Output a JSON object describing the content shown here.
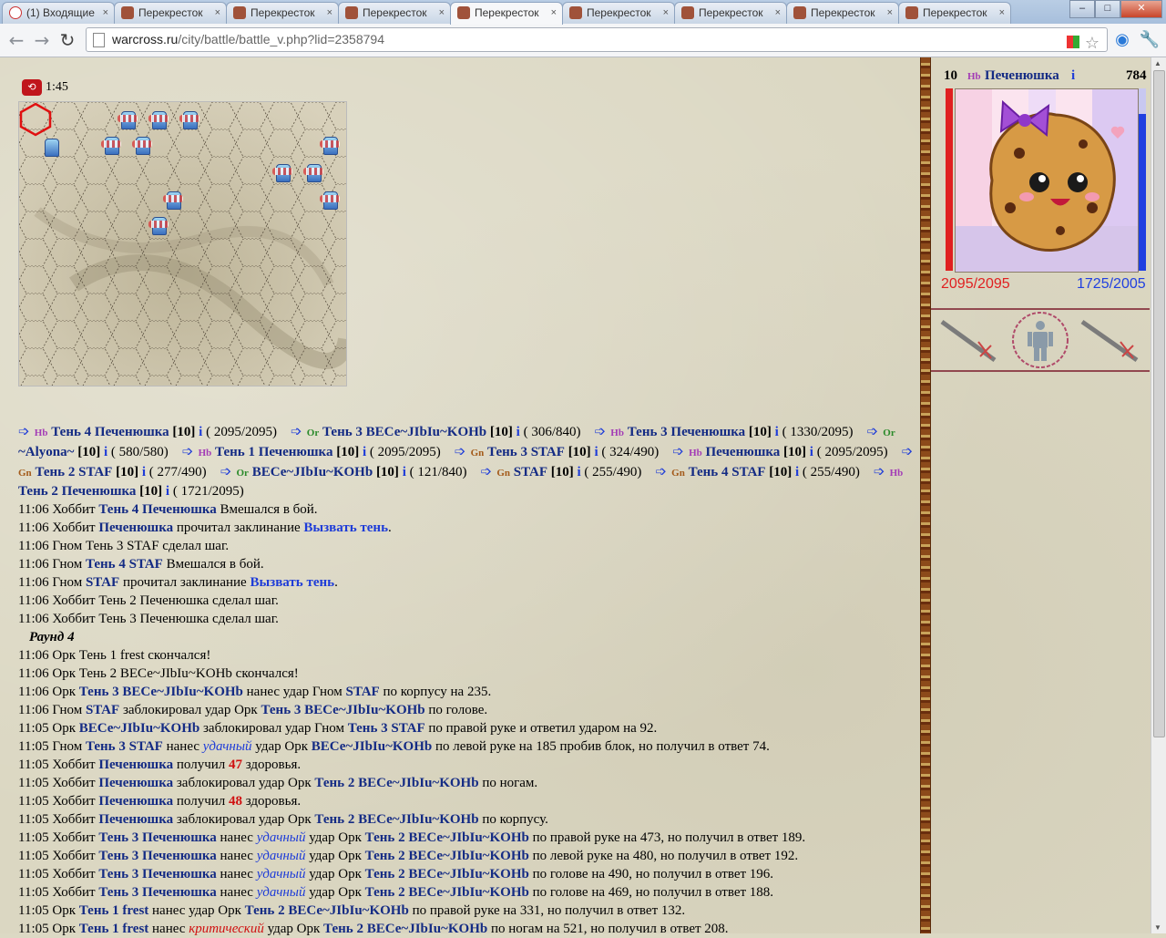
{
  "browser": {
    "tabs": [
      {
        "title": "(1) Входящие",
        "icon": "gmail-icon"
      },
      {
        "title": "Перекресток",
        "icon": "warcross-icon"
      },
      {
        "title": "Перекресток",
        "icon": "warcross-icon"
      },
      {
        "title": "Перекресток",
        "icon": "warcross-icon"
      },
      {
        "title": "Перекресток",
        "icon": "warcross-icon",
        "active": true
      },
      {
        "title": "Перекресток",
        "icon": "warcross-icon"
      },
      {
        "title": "Перекресток",
        "icon": "warcross-icon"
      },
      {
        "title": "Перекресток",
        "icon": "warcross-icon"
      },
      {
        "title": "Перекресток",
        "icon": "warcross-icon"
      }
    ],
    "url_host": "warcross.ru",
    "url_path": "/city/battle/battle_v.php?lid=2358794"
  },
  "battle": {
    "timer": "1:45"
  },
  "combatants": [
    {
      "race": "Hb",
      "name": "Тень 4 Печенюшка",
      "level": "[10]",
      "info": "i",
      "hp": "( 2095/2095)"
    },
    {
      "race": "Or",
      "name": "Тень 3 ВЕСе~JIbIu~KOHb",
      "level": "[10]",
      "info": "i",
      "hp": "( 306/840)"
    },
    {
      "race": "Hb",
      "name": "Тень 3 Печенюшка",
      "level": "[10]",
      "info": "i",
      "hp": "( 1330/2095)"
    },
    {
      "race": "Or",
      "name": "~Alyona~",
      "level": "[10]",
      "info": "i",
      "hp": "( 580/580)"
    },
    {
      "race": "Hb",
      "name": "Тень 1 Печенюшка",
      "level": "[10]",
      "info": "i",
      "hp": "( 2095/2095)"
    },
    {
      "race": "Gn",
      "name": "Тень 3 STAF",
      "level": "[10]",
      "info": "i",
      "hp": "( 324/490)"
    },
    {
      "race": "Hb",
      "name": "Печенюшка",
      "level": "[10]",
      "info": "i",
      "hp": "( 2095/2095)"
    },
    {
      "race": "Gn",
      "name": "Тень 2 STAF",
      "level": "[10]",
      "info": "i",
      "hp": "( 277/490)"
    },
    {
      "race": "Or",
      "name": "ВЕСе~JIbIu~KOHb",
      "level": "[10]",
      "info": "i",
      "hp": "( 121/840)"
    },
    {
      "race": "Gn",
      "name": "STAF",
      "level": "[10]",
      "info": "i",
      "hp": "( 255/490)"
    },
    {
      "race": "Gn",
      "name": "Тень 4 STAF",
      "level": "[10]",
      "info": "i",
      "hp": "( 255/490)"
    },
    {
      "race": "Hb",
      "name": "Тень 2 Печенюшка",
      "level": "[10]",
      "info": "i",
      "hp": "( 1721/2095)"
    }
  ],
  "log": [
    [
      {
        "t": "11:06 Хоббит "
      },
      {
        "a": "Тень 4 Печенюшка"
      },
      {
        "t": " Вмешался в бой."
      }
    ],
    [
      {
        "t": "11:06 Хоббит "
      },
      {
        "a": "Печенюшка"
      },
      {
        "t": " прочитал заклинание "
      },
      {
        "s": "Вызвать тень"
      },
      {
        "t": "."
      }
    ],
    [
      {
        "t": "11:06 Гном Тень 3 STAF сделал шаг."
      }
    ],
    [
      {
        "t": "11:06 Гном "
      },
      {
        "a": "Тень 4 STAF"
      },
      {
        "t": " Вмешался в бой."
      }
    ],
    [
      {
        "t": "11:06 Гном "
      },
      {
        "a": "STAF"
      },
      {
        "t": " прочитал заклинание "
      },
      {
        "s": "Вызвать тень"
      },
      {
        "t": "."
      }
    ],
    [
      {
        "t": "11:06 Хоббит Тень 2 Печенюшка сделал шаг."
      }
    ],
    [
      {
        "t": "11:06 Хоббит Тень 3 Печенюшка сделал шаг."
      }
    ],
    [
      {
        "r": "Раунд 4"
      }
    ],
    [
      {
        "t": "11:06 Орк Тень 1 frest скончался!"
      }
    ],
    [
      {
        "t": "11:06 Орк Тень 2 ВЕСе~JIbIu~KOHb скончался!"
      }
    ],
    [
      {
        "t": "11:06 Орк "
      },
      {
        "a": "Тень 3 ВЕСе~JIbIu~KOHb"
      },
      {
        "t": " нанес удар Гном "
      },
      {
        "a": "STAF"
      },
      {
        "t": " по корпусу на 235."
      }
    ],
    [
      {
        "t": "11:06 Гном "
      },
      {
        "a": "STAF"
      },
      {
        "t": " заблокировал удар Орк "
      },
      {
        "a": "Тень 3 ВЕСе~JIbIu~KOHb"
      },
      {
        "t": " по голове."
      }
    ],
    [
      {
        "t": "11:05 Орк "
      },
      {
        "a": "ВЕСе~JIbIu~KOHb"
      },
      {
        "t": " заблокировал удар Гном "
      },
      {
        "a": "Тень 3 STAF"
      },
      {
        "t": " по правой руке и ответил ударом на 92."
      }
    ],
    [
      {
        "t": "11:05 Гном "
      },
      {
        "a": "Тень 3 STAF"
      },
      {
        "t": " нанес "
      },
      {
        "l": "удачный"
      },
      {
        "t": " удар Орк "
      },
      {
        "a": "ВЕСе~JIbIu~KOHb"
      },
      {
        "t": " по левой руке на 185 пробив блок, но получил в ответ 74."
      }
    ],
    [
      {
        "t": "11:05 Хоббит "
      },
      {
        "a": "Печенюшка"
      },
      {
        "t": " получил "
      },
      {
        "d": "47"
      },
      {
        "t": " здоровья."
      }
    ],
    [
      {
        "t": "11:05 Хоббит "
      },
      {
        "a": "Печенюшка"
      },
      {
        "t": " заблокировал удар Орк "
      },
      {
        "a": "Тень 2 ВЕСе~JIbIu~KOHb"
      },
      {
        "t": " по ногам."
      }
    ],
    [
      {
        "t": "11:05 Хоббит "
      },
      {
        "a": "Печенюшка"
      },
      {
        "t": " получил "
      },
      {
        "d": "48"
      },
      {
        "t": " здоровья."
      }
    ],
    [
      {
        "t": "11:05 Хоббит "
      },
      {
        "a": "Печенюшка"
      },
      {
        "t": " заблокировал удар Орк "
      },
      {
        "a": "Тень 2 ВЕСе~JIbIu~KOHb"
      },
      {
        "t": " по корпусу."
      }
    ],
    [
      {
        "t": "11:05 Хоббит "
      },
      {
        "a": "Тень 3 Печенюшка"
      },
      {
        "t": " нанес "
      },
      {
        "l": "удачный"
      },
      {
        "t": " удар Орк "
      },
      {
        "a": "Тень 2 ВЕСе~JIbIu~KOHb"
      },
      {
        "t": " по правой руке на 473, но получил в ответ 189."
      }
    ],
    [
      {
        "t": "11:05 Хоббит "
      },
      {
        "a": "Тень 3 Печенюшка"
      },
      {
        "t": " нанес "
      },
      {
        "l": "удачный"
      },
      {
        "t": " удар Орк "
      },
      {
        "a": "Тень 2 ВЕСе~JIbIu~KOHb"
      },
      {
        "t": " по левой руке на 480, но получил в ответ 192."
      }
    ],
    [
      {
        "t": "11:05 Хоббит "
      },
      {
        "a": "Тень 3 Печенюшка"
      },
      {
        "t": " нанес "
      },
      {
        "l": "удачный"
      },
      {
        "t": " удар Орк "
      },
      {
        "a": "Тень 2 ВЕСе~JIbIu~KOHb"
      },
      {
        "t": " по голове на 490, но получил в ответ 196."
      }
    ],
    [
      {
        "t": "11:05 Хоббит "
      },
      {
        "a": "Тень 3 Печенюшка"
      },
      {
        "t": " нанес "
      },
      {
        "l": "удачный"
      },
      {
        "t": " удар Орк "
      },
      {
        "a": "Тень 2 ВЕСе~JIbIu~KOHb"
      },
      {
        "t": " по голове на 469, но получил в ответ 188."
      }
    ],
    [
      {
        "t": "11:05 Орк "
      },
      {
        "a": "Тень 1 frest"
      },
      {
        "t": " нанес удар Орк "
      },
      {
        "a": "Тень 2 ВЕСе~JIbIu~KOHb"
      },
      {
        "t": " по правой руке на 331, но получил в ответ 132."
      }
    ],
    [
      {
        "t": "11:05 Орк "
      },
      {
        "a": "Тень 1 frest"
      },
      {
        "t": " нанес "
      },
      {
        "c": "критический"
      },
      {
        "t": " удар Орк "
      },
      {
        "a": "Тень 2 ВЕСе~JIbIu~KOHb"
      },
      {
        "t": " по ногам на 521, но получил в ответ 208."
      }
    ]
  ],
  "profile": {
    "level": "10",
    "race": "Hb",
    "name": "Печенюшка",
    "info": "i",
    "exp": "784",
    "hp_text": "2095/2095",
    "mana_text": "1725/2005",
    "hp_fraction": 1.0,
    "mana_fraction": 0.86,
    "hp_color": "#e02020",
    "mana_color": "#2040e0"
  }
}
